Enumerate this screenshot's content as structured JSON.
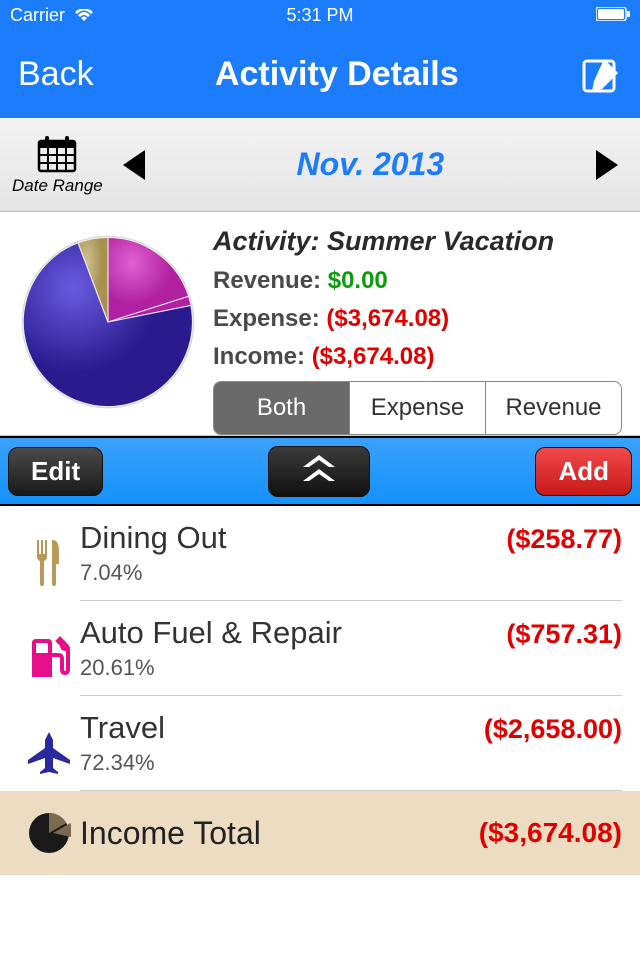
{
  "status": {
    "carrier": "Carrier",
    "time": "5:31 PM"
  },
  "nav": {
    "back": "Back",
    "title": "Activity Details"
  },
  "dateBar": {
    "rangeLabel": "Date Range",
    "current": "Nov. 2013"
  },
  "summary": {
    "activityLabel": "Activity: Summer Vacation",
    "revenueLabel": "Revenue:",
    "revenueValue": "$0.00",
    "expenseLabel": "Expense:",
    "expenseValue": "($3,674.08)",
    "incomeLabel": "Income:",
    "incomeValue": "($3,674.08)"
  },
  "segment": {
    "both": "Both",
    "expense": "Expense",
    "revenue": "Revenue"
  },
  "toolbar": {
    "edit": "Edit",
    "add": "Add"
  },
  "categories": [
    {
      "name": "Dining Out",
      "pct": "7.04%",
      "amount": "($258.77)",
      "icon": "dining",
      "color": "#b8995a"
    },
    {
      "name": "Auto Fuel & Repair",
      "pct": "20.61%",
      "amount": "($757.31)",
      "icon": "fuel",
      "color": "#e80d8a"
    },
    {
      "name": "Travel",
      "pct": "72.34%",
      "amount": "($2,658.00)",
      "icon": "plane",
      "color": "#2a2a9e"
    }
  ],
  "total": {
    "label": "Income Total",
    "amount": "($3,674.08)"
  },
  "chart_data": {
    "type": "pie",
    "categories": [
      "Dining Out",
      "Auto Fuel & Repair",
      "Travel"
    ],
    "values": [
      7.04,
      20.61,
      72.34
    ],
    "colors": [
      "#b8995a",
      "#c63db8",
      "#3a2a9e"
    ]
  },
  "colors": {
    "primary": "#1b7cfc",
    "negative": "#e00000",
    "positive": "#0a9c0a"
  }
}
